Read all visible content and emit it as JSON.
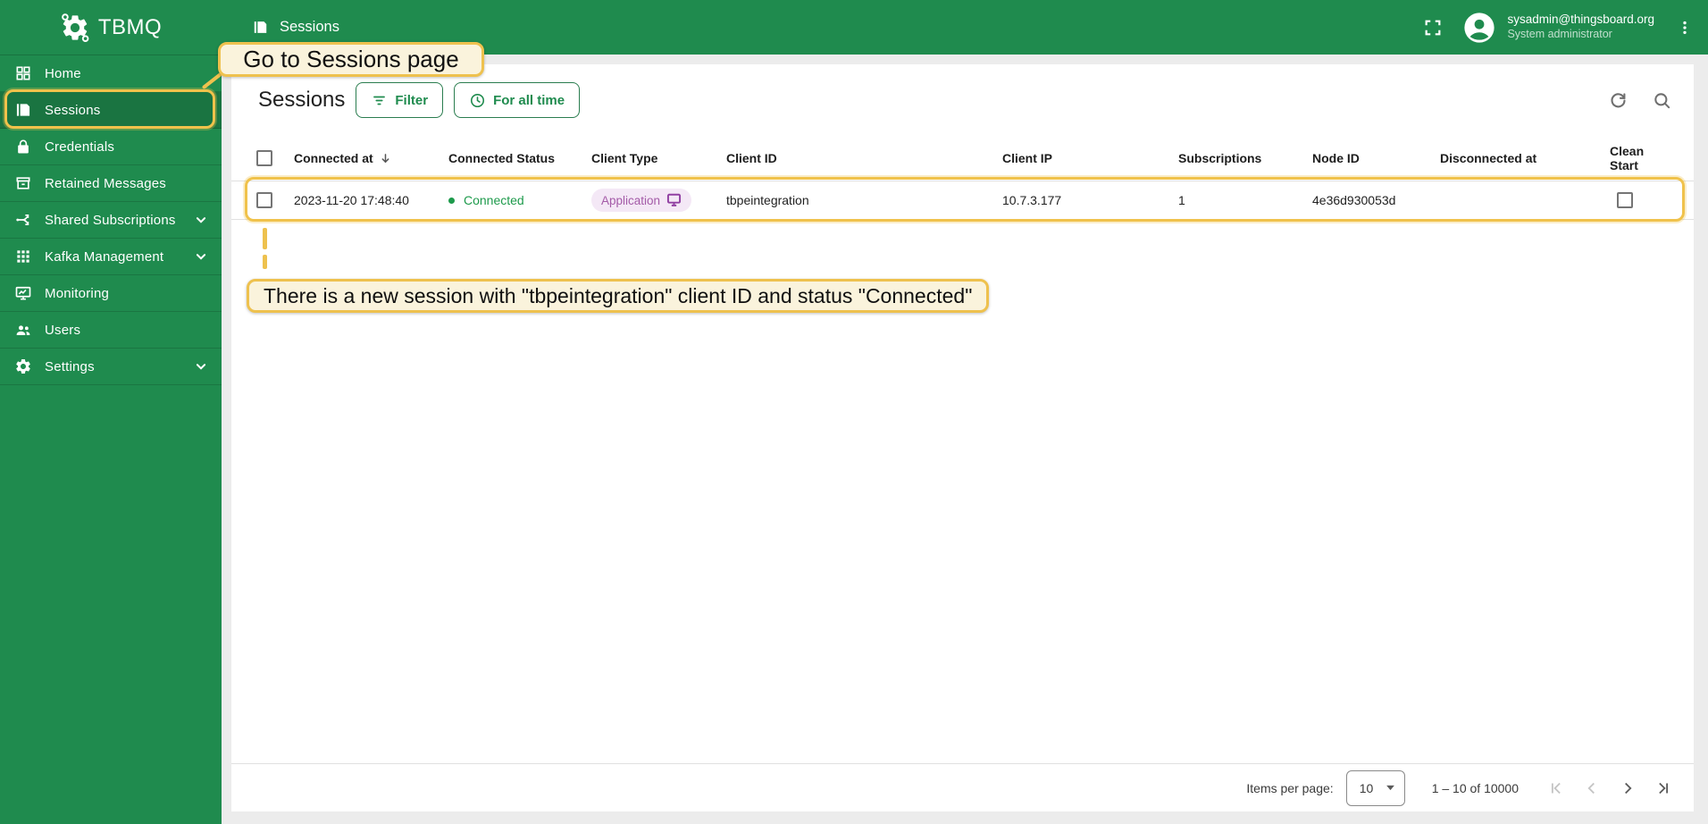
{
  "app": {
    "name": "TBMQ"
  },
  "topbar": {
    "title": "Sessions",
    "user": {
      "email": "sysadmin@thingsboard.org",
      "role": "System administrator"
    }
  },
  "sidebar": {
    "items": [
      {
        "label": "Home",
        "icon": "home-dashboard-icon",
        "selected": false,
        "expandable": false
      },
      {
        "label": "Sessions",
        "icon": "sessions-book-icon",
        "selected": true,
        "expandable": false
      },
      {
        "label": "Credentials",
        "icon": "lock-icon",
        "selected": false,
        "expandable": false
      },
      {
        "label": "Retained Messages",
        "icon": "retained-messages-icon",
        "selected": false,
        "expandable": false
      },
      {
        "label": "Shared Subscriptions",
        "icon": "shared-subscriptions-icon",
        "selected": false,
        "expandable": true
      },
      {
        "label": "Kafka Management",
        "icon": "kafka-apps-icon",
        "selected": false,
        "expandable": true
      },
      {
        "label": "Monitoring",
        "icon": "monitoring-icon",
        "selected": false,
        "expandable": false
      },
      {
        "label": "Users",
        "icon": "users-icon",
        "selected": false,
        "expandable": false
      },
      {
        "label": "Settings",
        "icon": "settings-gear-icon",
        "selected": false,
        "expandable": true
      }
    ]
  },
  "toolbar": {
    "title": "Sessions",
    "filter_label": "Filter",
    "time_range_label": "For all time"
  },
  "table": {
    "columns": [
      "Connected at",
      "Connected Status",
      "Client Type",
      "Client ID",
      "Client IP",
      "Subscriptions",
      "Node ID",
      "Disconnected at",
      "Clean Start"
    ],
    "rows": [
      {
        "connected_at": "2023-11-20 17:48:40",
        "connected_status": "Connected",
        "client_type": "Application",
        "client_id": "tbpeintegration",
        "client_ip": "10.7.3.177",
        "subscriptions": "1",
        "node_id": "4e36d930053d",
        "disconnected_at": "",
        "clean_start": false
      }
    ]
  },
  "pagination": {
    "items_per_page_label": "Items per page:",
    "page_size": "10",
    "range_label": "1 – 10 of 10000"
  },
  "annotations": {
    "goto_sessions": "Go to Sessions page",
    "new_session": "There is a new session with \"tbpeintegration\" client ID and status \"Connected\""
  },
  "colors": {
    "primary_green": "#1f8b4e",
    "status_connected": "#1d9a4b",
    "annotation_gold": "#f0c24b",
    "annotation_bg": "#faf3dc",
    "chip_bg": "#f4e8f6",
    "chip_text": "#a45ba8"
  }
}
